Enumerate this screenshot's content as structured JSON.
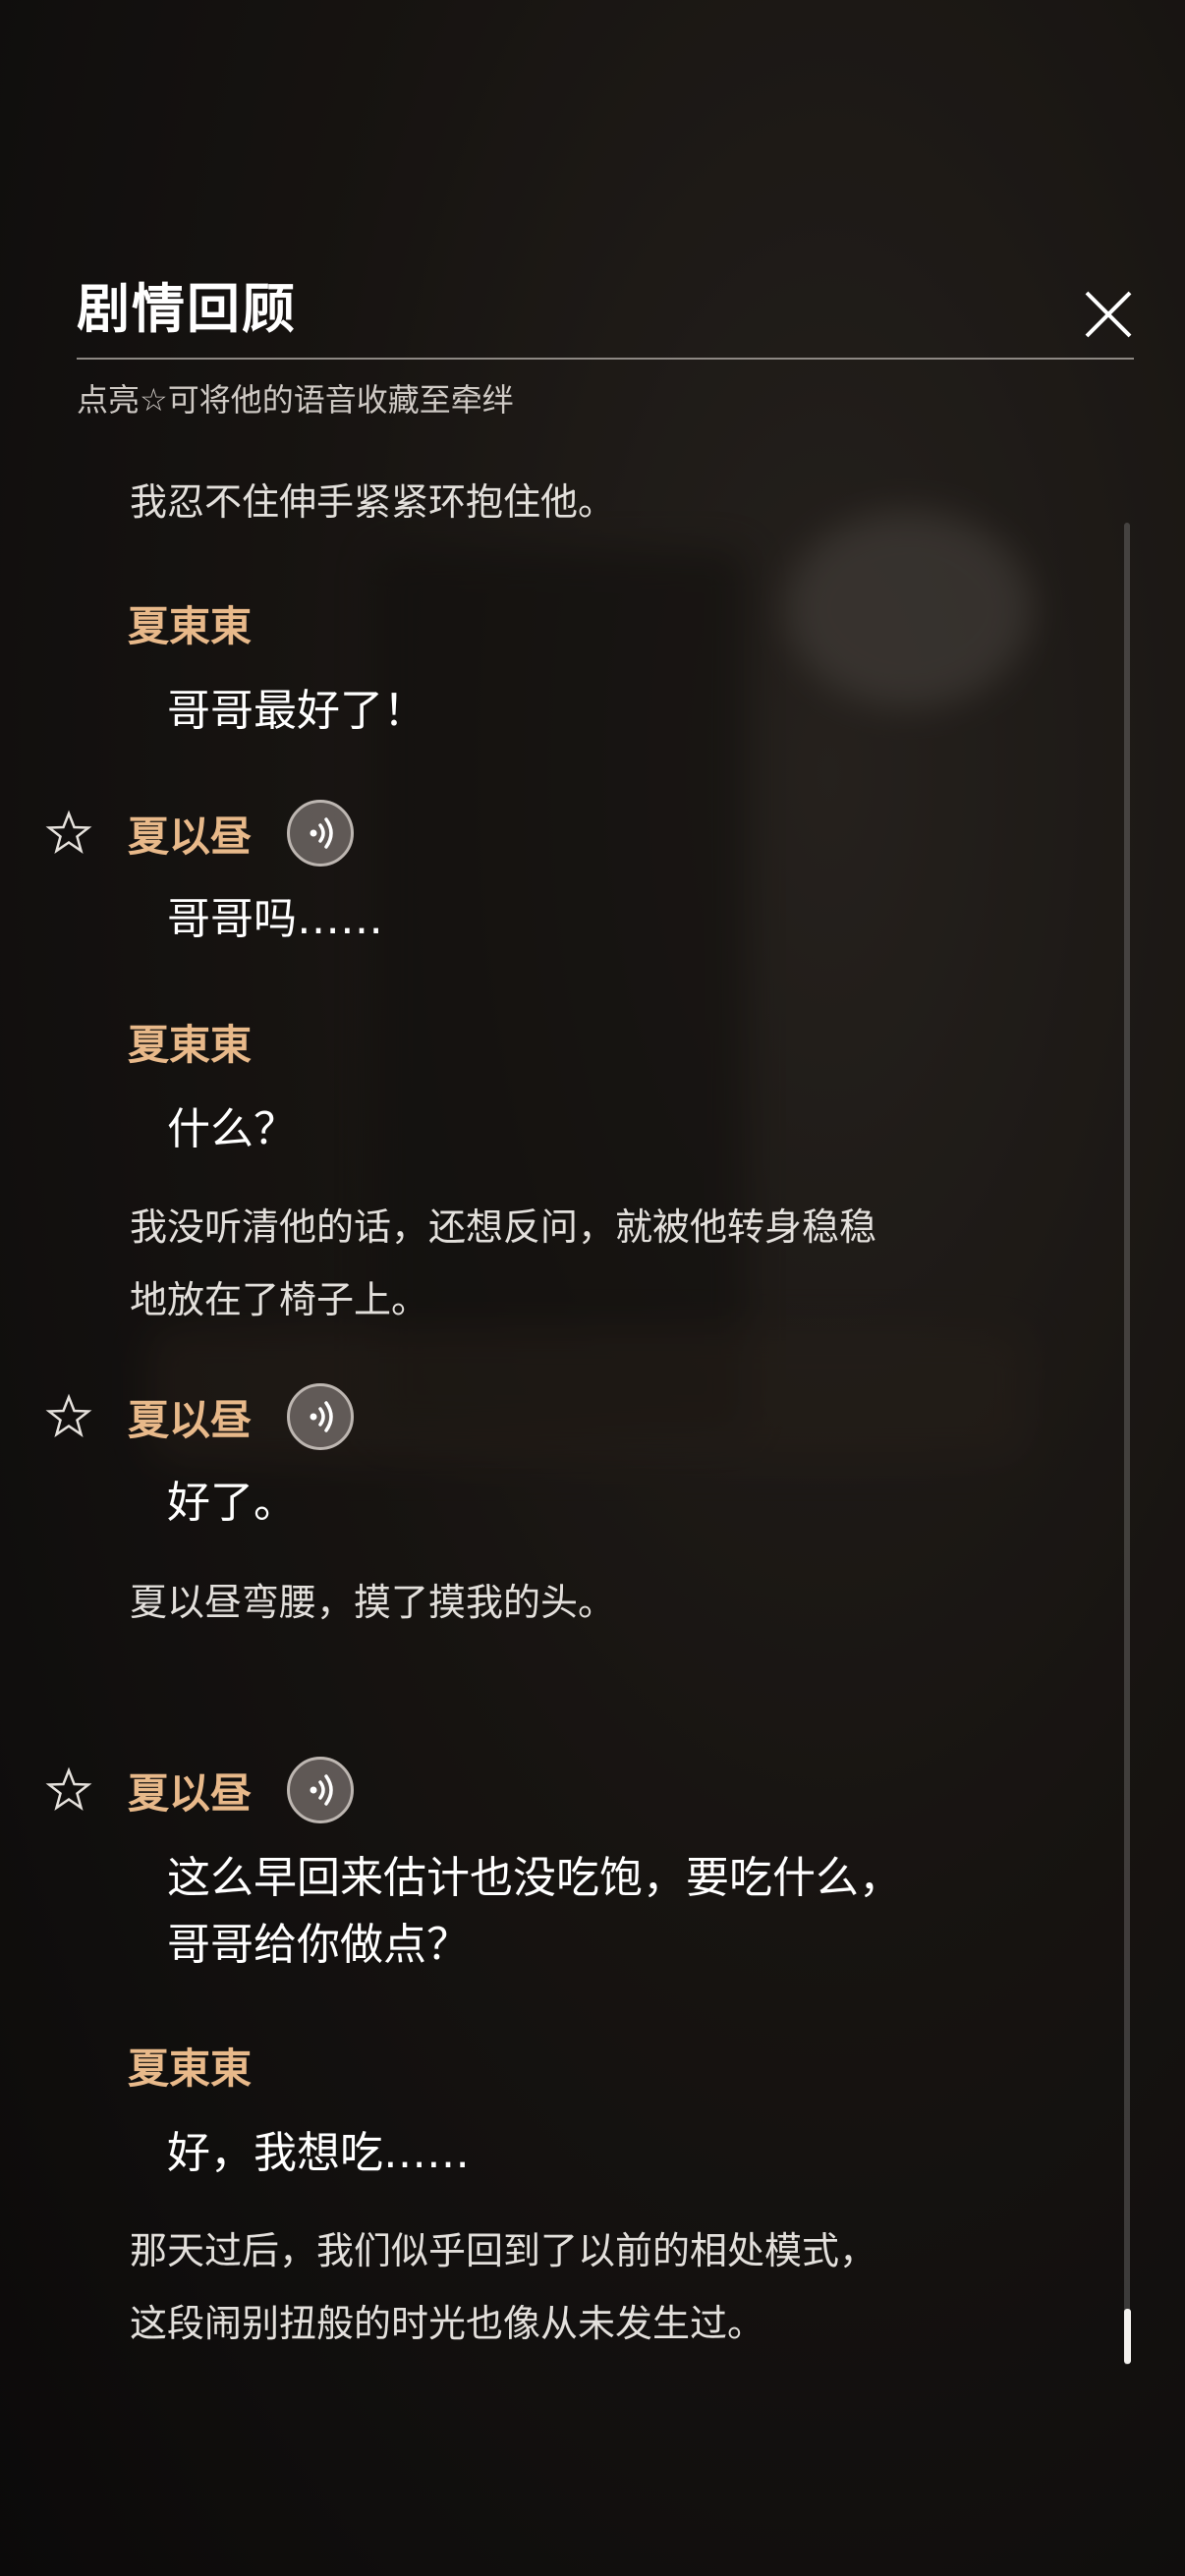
{
  "header": {
    "title": "剧情回顾",
    "subtitle": "点亮☆可将他的语音收藏至牵绊"
  },
  "entries": [
    {
      "type": "narration",
      "text": "我忍不住伸手紧紧环抱住他。"
    },
    {
      "type": "speaker",
      "name": "夏東東"
    },
    {
      "type": "dialogue",
      "text": "哥哥最好了！"
    },
    {
      "type": "speaker",
      "name": "夏以昼",
      "star": true,
      "voice": true
    },
    {
      "type": "dialogue",
      "text": "哥哥吗……"
    },
    {
      "type": "speaker",
      "name": "夏東東"
    },
    {
      "type": "dialogue",
      "text": "什么？"
    },
    {
      "type": "narration",
      "line1": "我没听清他的话，还想反问，就被他转身稳稳",
      "line2": "地放在了椅子上。"
    },
    {
      "type": "speaker",
      "name": "夏以昼",
      "star": true,
      "voice": true
    },
    {
      "type": "dialogue",
      "text": "好了。"
    },
    {
      "type": "narration",
      "text": "夏以昼弯腰，摸了摸我的头。"
    },
    {
      "type": "speaker",
      "name": "夏以昼",
      "star": true,
      "voice": true
    },
    {
      "type": "dialogue",
      "line1": "这么早回来估计也没吃饱，要吃什么，",
      "line2": "哥哥给你做点？"
    },
    {
      "type": "speaker",
      "name": "夏東東"
    },
    {
      "type": "dialogue",
      "text": "好，我想吃……"
    },
    {
      "type": "narration",
      "line1": "那天过后，我们似乎回到了以前的相处模式，",
      "line2": "这段闹别扭般的时光也像从未发生过。"
    }
  ],
  "icons": {
    "star": "star-outline-icon",
    "voice": "voice-play-icon",
    "close": "close-icon"
  },
  "colors": {
    "speaker": "#e8b98a",
    "text": "#ffffff",
    "narration": "#e3e0dc"
  }
}
